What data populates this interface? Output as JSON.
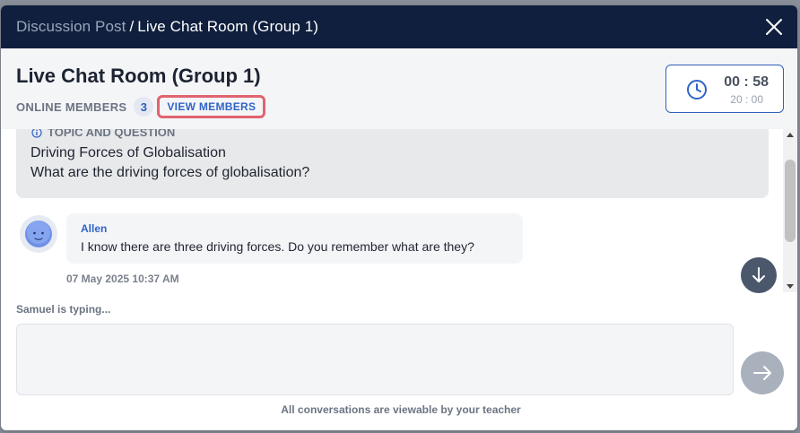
{
  "breadcrumb": {
    "parent": "Discussion Post",
    "separator": "/",
    "current": "Live Chat Room (Group 1)"
  },
  "header": {
    "title": "Live Chat Room (Group 1)",
    "online_members_label": "ONLINE MEMBERS",
    "online_members_count": "3",
    "view_members_label": "VIEW MEMBERS"
  },
  "timer": {
    "remaining": "00 : 58",
    "total": "20 : 00"
  },
  "topic": {
    "label": "TOPIC AND QUESTION",
    "title": "Driving Forces of Globalisation",
    "question": "What are the driving forces of globalisation?"
  },
  "messages": [
    {
      "sender": "Allen",
      "text": "I know there are three driving forces. Do you remember what are they?",
      "timestamp": "07 May 2025 10:37 AM"
    }
  ],
  "typing_indicator": "Samuel is typing...",
  "composer": {
    "value": "",
    "placeholder": ""
  },
  "footer_note": "All conversations are viewable by your teacher",
  "icons": {
    "close": "close-icon",
    "timer": "clock-icon",
    "info": "info-icon",
    "scroll_down": "arrow-down-icon",
    "send": "arrow-right-icon",
    "avatar": "avatar-face-icon"
  },
  "colors": {
    "titlebar_bg": "#0f1f3d",
    "accent": "#2f64c8",
    "highlight_border": "#e06470",
    "send_button": "#a9b1bd",
    "scroll_button": "#4b586b"
  }
}
